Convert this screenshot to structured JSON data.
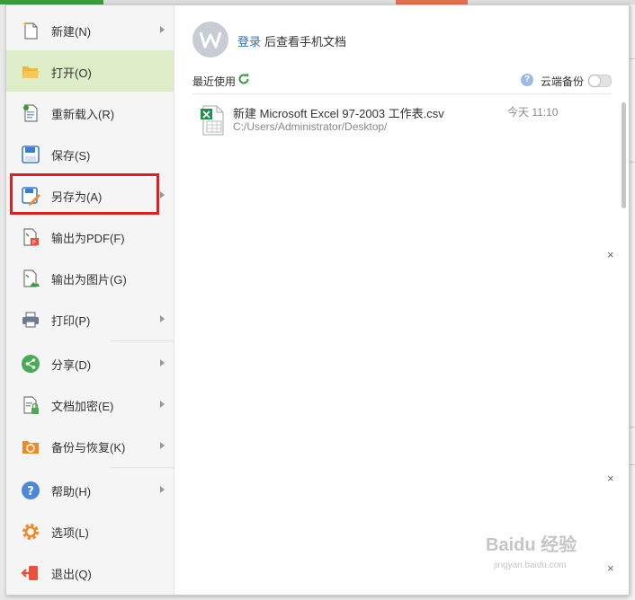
{
  "menu": {
    "items": [
      {
        "label": "新建(N)",
        "icon": "new-doc-icon",
        "submenu": true
      },
      {
        "label": "打开(O)",
        "icon": "folder-open-icon",
        "submenu": false,
        "active": true
      },
      {
        "label": "重新载入(R)",
        "icon": "reload-icon",
        "submenu": false
      },
      {
        "label": "保存(S)",
        "icon": "save-icon",
        "submenu": false
      },
      {
        "label": "另存为(A)",
        "icon": "save-as-icon",
        "submenu": true
      },
      {
        "label": "输出为PDF(F)",
        "icon": "pdf-icon",
        "submenu": false
      },
      {
        "label": "输出为图片(G)",
        "icon": "image-icon",
        "submenu": false
      },
      {
        "label": "打印(P)",
        "icon": "printer-icon",
        "submenu": true
      },
      {
        "label": "分享(D)",
        "icon": "share-icon",
        "submenu": true
      },
      {
        "label": "文档加密(E)",
        "icon": "encrypt-icon",
        "submenu": true
      },
      {
        "label": "备份与恢复(K)",
        "icon": "backup-icon",
        "submenu": true
      },
      {
        "label": "帮助(H)",
        "icon": "help-icon",
        "submenu": true
      },
      {
        "label": "选项(L)",
        "icon": "gear-icon",
        "submenu": false
      },
      {
        "label": "退出(Q)",
        "icon": "exit-icon",
        "submenu": false
      }
    ]
  },
  "login": {
    "link": "登录",
    "text": "后查看手机文档"
  },
  "recent": {
    "label": "最近使用",
    "cloud_label": "云端备份",
    "cloud_enabled": false,
    "files": [
      {
        "name": "新建 Microsoft Excel 97-2003 工作表.csv",
        "path": "C:/Users/Administrator/Desktop/",
        "time": "今天 11:10"
      }
    ]
  },
  "watermark": {
    "text": "Baidu 经验",
    "sub": "jingyan.baidu.com"
  },
  "colors": {
    "active_bg": "#dcedc8",
    "accent_green": "#3c9a3c",
    "link_blue": "#2f6fbd",
    "highlight_red": "#e02020"
  }
}
